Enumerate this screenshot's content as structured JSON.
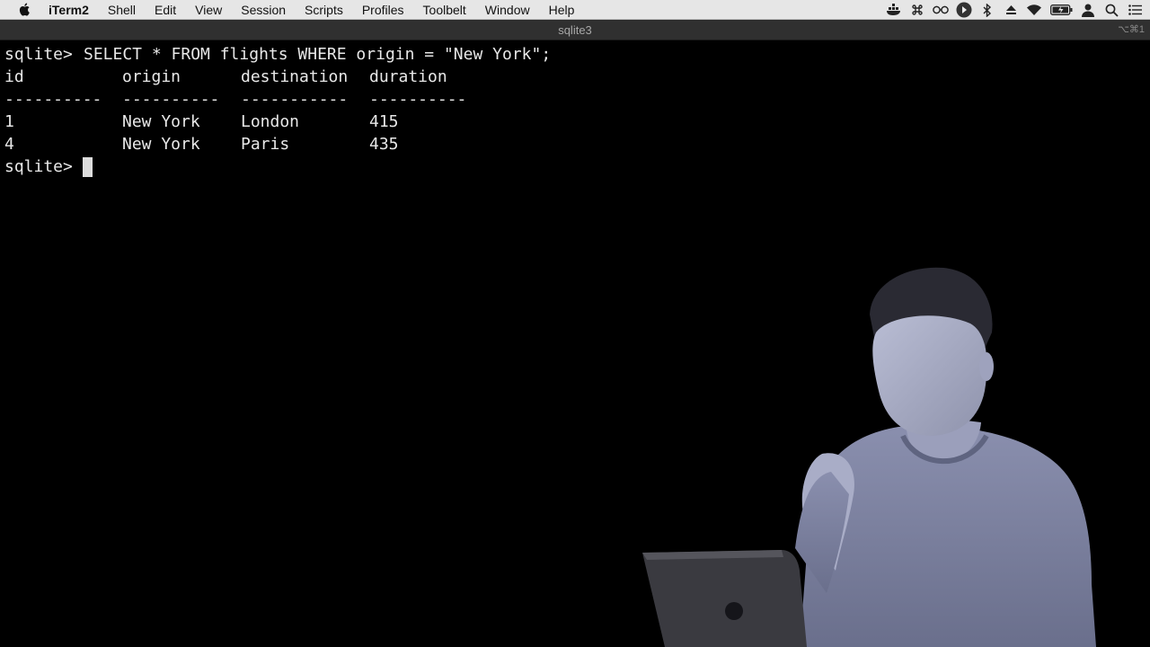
{
  "menubar": {
    "items": [
      "iTerm2",
      "Shell",
      "Edit",
      "View",
      "Session",
      "Scripts",
      "Profiles",
      "Toolbelt",
      "Window",
      "Help"
    ],
    "status_icons": [
      "docker-icon",
      "command-icon",
      "glasses-icon",
      "play-circle-icon",
      "bluetooth-icon",
      "eject-icon",
      "wifi-icon",
      "battery-icon",
      "user-icon",
      "search-icon",
      "list-icon"
    ]
  },
  "window": {
    "title": "sqlite3",
    "shortcut": "⌥⌘1"
  },
  "terminal": {
    "prompt": "sqlite>",
    "command": "SELECT * FROM flights WHERE origin = \"New York\";",
    "columns": [
      "id",
      "origin",
      "destination",
      "duration"
    ],
    "separators": [
      "----------",
      "----------",
      "-----------",
      "----------"
    ],
    "rows": [
      [
        "1",
        "New York",
        "London",
        "415"
      ],
      [
        "4",
        "New York",
        "Paris",
        "435"
      ]
    ]
  },
  "colors": {
    "terminal_bg": "#000000",
    "terminal_fg": "#e8e8e8",
    "menubar_bg": "#e6e6e6",
    "titlebar_bg": "#303030"
  }
}
